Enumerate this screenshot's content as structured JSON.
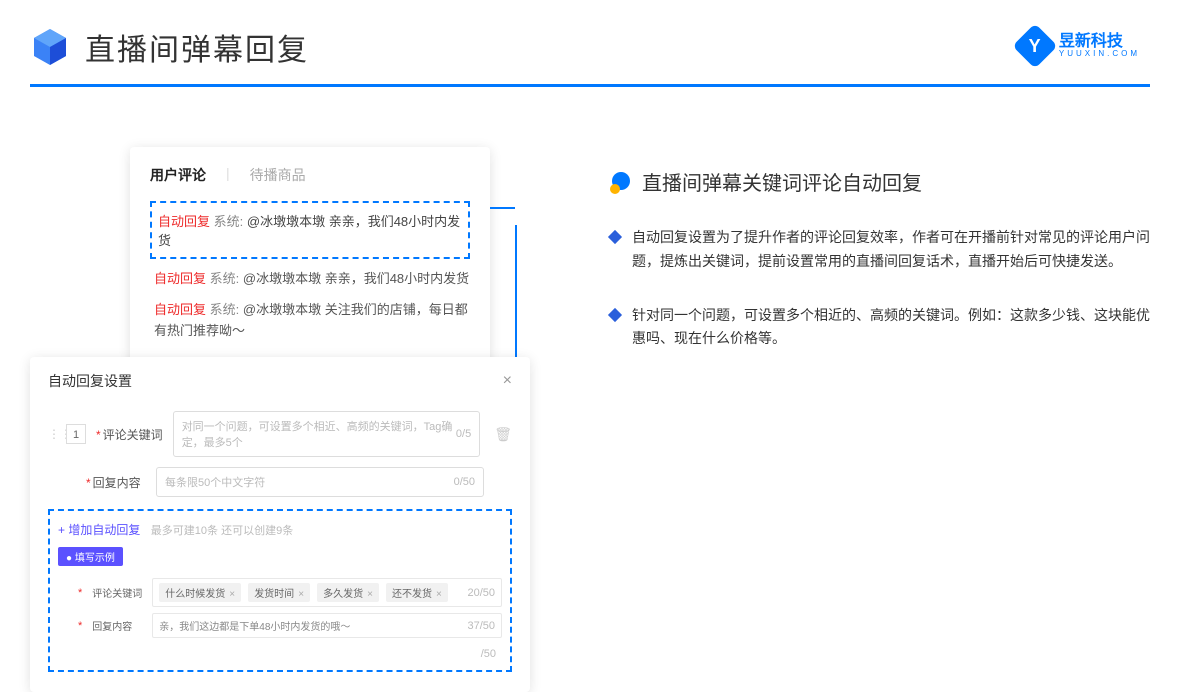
{
  "header": {
    "title": "直播间弹幕回复"
  },
  "logo": {
    "cn": "昱新科技",
    "en": "YUUXIN.COM",
    "letter": "Y"
  },
  "comments": {
    "tabs": {
      "active": "用户评论",
      "inactive": "待播商品"
    },
    "highlighted": {
      "auto": "自动回复",
      "system": "系统:",
      "text": "@冰墩墩本墩 亲亲，我们48小时内发货"
    },
    "line2": {
      "auto": "自动回复",
      "system": "系统:",
      "text": "@冰墩墩本墩 亲亲，我们48小时内发货"
    },
    "line3": {
      "auto": "自动回复",
      "system": "系统:",
      "text": "@冰墩墩本墩 关注我们的店铺，每日都有热门推荐呦～"
    }
  },
  "settings": {
    "title": "自动回复设置",
    "order": "1",
    "keyword_label": "评论关键词",
    "keyword_placeholder": "对同一个问题，可设置多个相近、高频的关键词，Tag确定，最多5个",
    "keyword_count": "0/5",
    "content_label": "回复内容",
    "content_placeholder": "每条限50个中文字符",
    "content_count": "0/50",
    "add_link": "+ 增加自动回复",
    "add_hint": "最多可建10条 还可以创建9条",
    "example_badge": "● 填写示例",
    "ex_keyword_label": "评论关键词",
    "ex_tags": [
      "什么时候发货",
      "发货时间",
      "多久发货",
      "还不发货"
    ],
    "ex_keyword_count": "20/50",
    "ex_content_label": "回复内容",
    "ex_content_text": "亲，我们这边都是下单48小时内发货的哦～",
    "ex_content_count": "37/50",
    "extra_count": "/50"
  },
  "right": {
    "title": "直播间弹幕关键词评论自动回复",
    "bullets": [
      "自动回复设置为了提升作者的评论回复效率，作者可在开播前针对常见的评论用户问题，提炼出关键词，提前设置常用的直播间回复话术，直播开始后可快捷发送。",
      "针对同一个问题，可设置多个相近的、高频的关键词。例如：这款多少钱、这块能优惠吗、现在什么价格等。"
    ]
  }
}
